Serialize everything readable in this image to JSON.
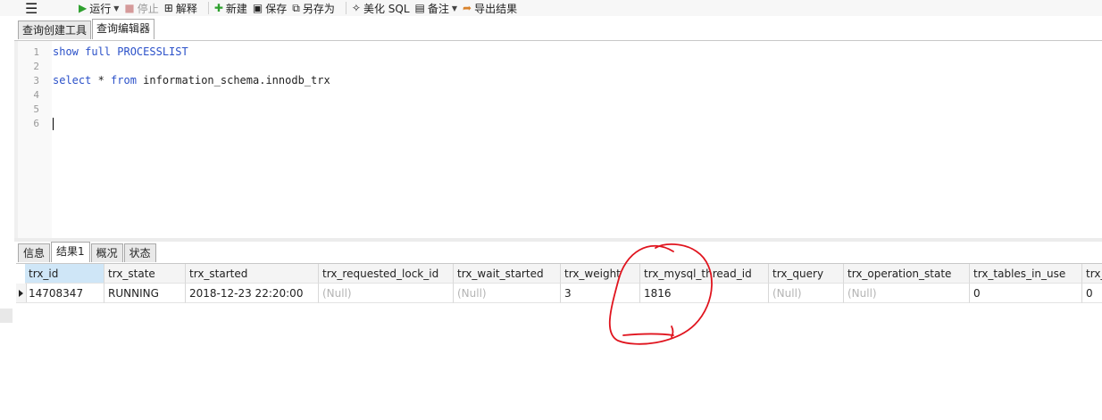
{
  "toolbar": {
    "menu_icon": "hamburger-menu-icon",
    "run_label": "运行",
    "stop_label": "停止",
    "explain_label": "解释",
    "new_label": "新建",
    "save_label": "保存",
    "save_as_label": "另存为",
    "beautify_label": "美化 SQL",
    "comment_label": "备注",
    "export_label": "导出结果"
  },
  "editor_tabs": [
    {
      "label": "查询创建工具"
    },
    {
      "label": "查询编辑器"
    }
  ],
  "editor": {
    "line_numbers": [
      "1",
      "2",
      "3",
      "4",
      "5",
      "6"
    ],
    "line1": {
      "kw": "show full PROCESSLIST"
    },
    "line3": {
      "kw1": "select",
      "mid": " * ",
      "kw2": "from",
      "rest": " information_schema.innodb_trx"
    }
  },
  "result_tabs": [
    {
      "label": "信息"
    },
    {
      "label": "结果1"
    },
    {
      "label": "概况"
    },
    {
      "label": "状态"
    }
  ],
  "grid": {
    "columns": [
      "trx_id",
      "trx_state",
      "trx_started",
      "trx_requested_lock_id",
      "trx_wait_started",
      "trx_weight",
      "trx_mysql_thread_id",
      "trx_query",
      "trx_operation_state",
      "trx_tables_in_use",
      "trx_"
    ],
    "rows": [
      [
        "14708347",
        "RUNNING",
        "2018-12-23 22:20:00",
        "(Null)",
        "(Null)",
        "3",
        "1816",
        "(Null)",
        "(Null)",
        "0",
        "0"
      ]
    ]
  },
  "colors": {
    "keyword": "#2b51c9",
    "annotation": "#e0141e",
    "run_green": "#2ea02e",
    "header_selected": "#cfe6f7"
  }
}
